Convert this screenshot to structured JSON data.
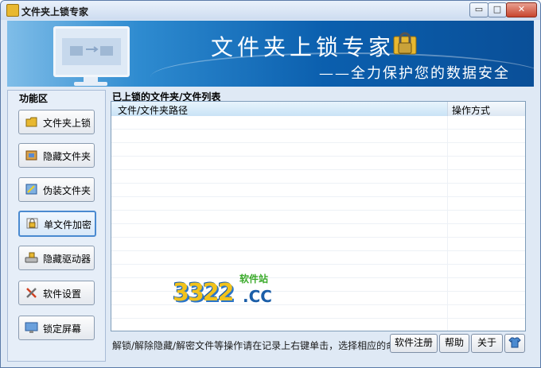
{
  "window": {
    "title": "文件夹上锁专家"
  },
  "title_controls": {
    "minimize_symbol": "▭",
    "maximize_symbol": "□",
    "close_symbol": "✕"
  },
  "banner": {
    "title": "文件夹上锁专家",
    "slogan": "——全力保护您的数据安全"
  },
  "sidebar": {
    "title": "功能区",
    "items": [
      {
        "label": "文件夹上锁",
        "icon": "folder-lock-icon"
      },
      {
        "label": "隐藏文件夹",
        "icon": "hide-folder-icon"
      },
      {
        "label": "伪装文件夹",
        "icon": "disguise-folder-icon"
      },
      {
        "label": "单文件加密",
        "icon": "file-encrypt-icon",
        "active": true
      },
      {
        "label": "隐藏驱动器",
        "icon": "hide-drive-icon"
      },
      {
        "label": "软件设置",
        "icon": "settings-tools-icon"
      },
      {
        "label": "锁定屏幕",
        "icon": "lock-screen-icon"
      }
    ]
  },
  "list": {
    "title": "已上锁的文件夹/文件列表",
    "columns": [
      "文件/文件夹路径",
      "操作方式"
    ],
    "rows": []
  },
  "watermark": {
    "number": "3322",
    "suffix": ".CC",
    "site_text": "软件站"
  },
  "status": {
    "hint": "解锁/解除隐藏/解密文件等操作请在记录上右键单击，选择相应的命令。"
  },
  "footer": {
    "register_label": "软件注册",
    "help_label": "帮助",
    "about_label": "关于",
    "skin_icon": "skin-shirt-icon"
  },
  "colors": {
    "banner_blue": "#0b5fae",
    "accent": "#4a8ad0",
    "watermark_yellow": "#f2c21b",
    "watermark_green": "#3aaa2a"
  }
}
